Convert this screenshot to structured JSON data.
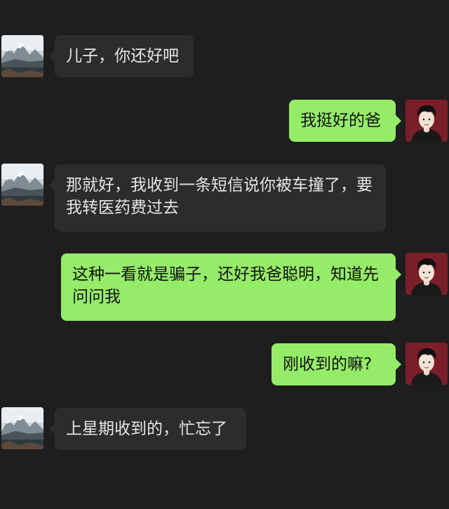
{
  "colors": {
    "background": "#1e1e1e",
    "incoming_bubble": "#2c2c2c",
    "outgoing_bubble": "#95ec69",
    "incoming_text": "#e6e6e6",
    "outgoing_text": "#111111"
  },
  "avatars": {
    "dad": "mountain-landscape-avatar",
    "son": "cartoon-boy-avatar"
  },
  "messages": [
    {
      "sender": "dad",
      "text": "儿子，你还好吧"
    },
    {
      "sender": "son",
      "text": "我挺好的爸"
    },
    {
      "sender": "dad",
      "text": "那就好，我收到一条短信说你被车撞了，要我转医药费过去"
    },
    {
      "sender": "son",
      "text": "这种一看就是骗子，还好我爸聪明，知道先问问我"
    },
    {
      "sender": "son",
      "text": "刚收到的嘛?"
    },
    {
      "sender": "dad",
      "text": "上星期收到的，忙忘了"
    }
  ]
}
